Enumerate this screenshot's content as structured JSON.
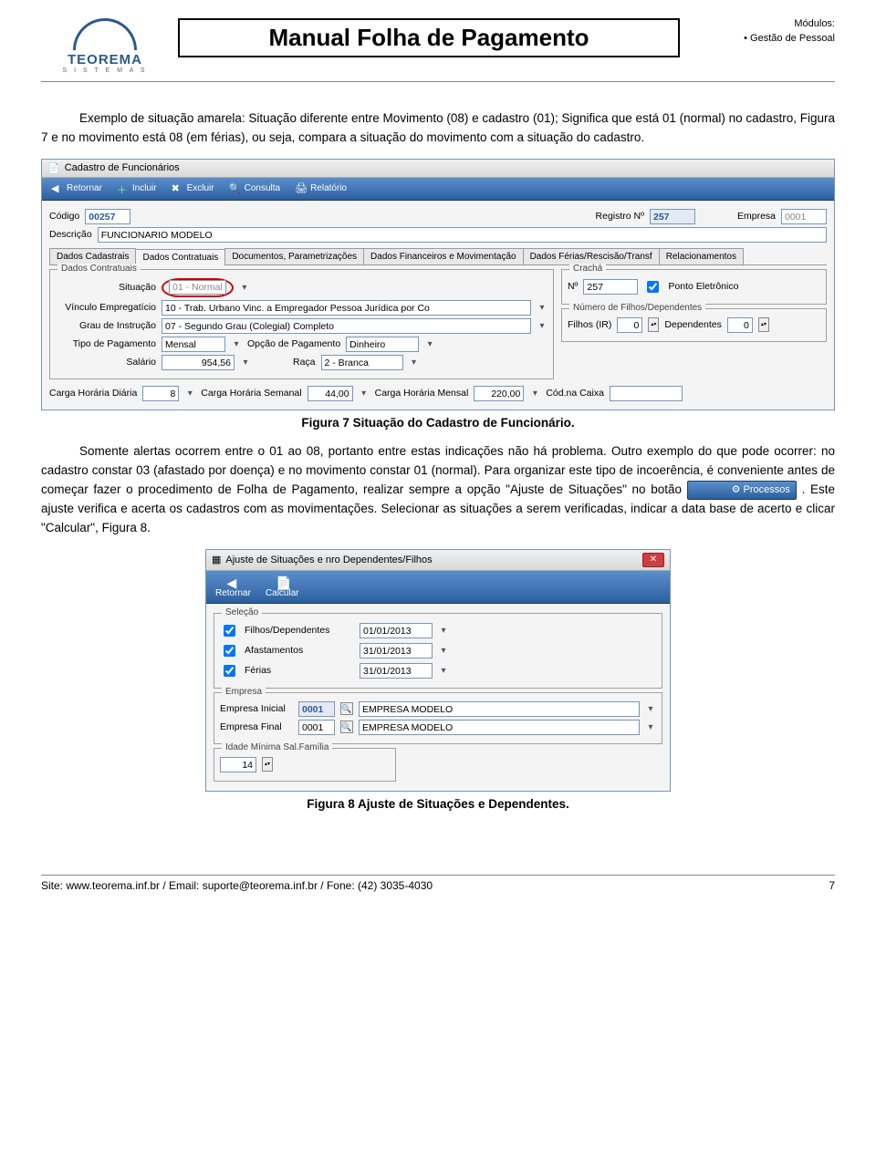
{
  "header": {
    "logo_name": "TEOREMA",
    "logo_sub": "S I S T E M A S",
    "title": "Manual Folha de Pagamento",
    "modules_label": "Módulos:",
    "module_item": "Gestão de Pessoal"
  },
  "para1": "Exemplo de situação amarela: Situação diferente entre Movimento (08) e cadastro (01); Significa que está 01 (normal) no cadastro, Figura 7 e no movimento está 08 (em férias), ou seja, compara a situação do movimento com a situação do cadastro.",
  "fig7": {
    "win_title": "Cadastro de Funcionários",
    "toolbar": {
      "retornar": "Retornar",
      "incluir": "Incluir",
      "excluir": "Excluir",
      "consulta": "Consulta",
      "relatorio": "Relatório"
    },
    "codigo_lbl": "Código",
    "codigo_val": "00257",
    "registro_lbl": "Registro Nº",
    "registro_val": "257",
    "empresa_lbl": "Empresa",
    "empresa_val": "0001",
    "descricao_lbl": "Descrição",
    "descricao_val": "FUNCIONARIO MODELO",
    "tabs": {
      "t1": "Dados Cadastrais",
      "t2": "Dados Contratuais",
      "t3": "Documentos, Parametrizações",
      "t4": "Dados Financeiros e Movimentação",
      "t5": "Dados Férias/Rescisão/Transf",
      "t6": "Relacionamentos"
    },
    "group_contrat": "Dados Contratuais",
    "situacao_lbl": "Situação",
    "situacao_val": "01 - Normal",
    "vinculo_lbl": "Vínculo Empregatício",
    "vinculo_val": "10 - Trab. Urbano Vinc. a Empregador Pessoa Jurídica por Co",
    "grau_lbl": "Grau de Instrução",
    "grau_val": "07 - Segundo Grau (Colegial) Completo",
    "tipopag_lbl": "Tipo de Pagamento",
    "tipopag_val": "Mensal",
    "opcaopag_lbl": "Opção de Pagamento",
    "opcaopag_val": "Dinheiro",
    "salario_lbl": "Salário",
    "salario_val": "954,56",
    "raca_lbl": "Raça",
    "raca_val": "2 - Branca",
    "chd_lbl": "Carga Horária Diária",
    "chd_val": "8",
    "chs_lbl": "Carga Horária Semanal",
    "chs_val": "44,00",
    "chm_lbl": "Carga Horária Mensal",
    "chm_val": "220,00",
    "codcaixa_lbl": "Cód.na Caixa",
    "group_cracha": "Crachá",
    "cracha_no_lbl": "Nº",
    "cracha_no_val": "257",
    "ponto_lbl": "Ponto Eletrônico",
    "group_filhos": "Número de Filhos/Dependentes",
    "filhosir_lbl": "Filhos (IR)",
    "filhosir_val": "0",
    "dependentes_lbl": "Dependentes",
    "dependentes_val": "0"
  },
  "caption7": "Figura 7 Situação do Cadastro de Funcionário.",
  "para2a": "Somente alertas ocorrem entre o 01 ao 08, portanto entre estas indicações não há problema. Outro exemplo do que pode ocorrer: no cadastro constar 03 (afastado por doença) e no movimento constar 01 (normal). Para organizar este tipo de incoerência, é conveniente antes de começar fazer o procedimento de Folha de Pagamento, realizar sempre a opção \"Ajuste de Situações\" no botão ",
  "processos_btn": "Processos",
  "para2b": ". Este ajuste verifica e acerta os cadastros com as movimentações. Selecionar as situações a serem verificadas, indicar a data base de acerto e clicar \"Calcular\", Figura 8.",
  "fig8": {
    "win_title": "Ajuste de Situações e nro Dependentes/Filhos",
    "toolbar": {
      "retornar": "Retornar",
      "calcular": "Calcular"
    },
    "group_selecao": "Seleção",
    "filhos_lbl": "Filhos/Dependentes",
    "filhos_date": "01/01/2013",
    "afast_lbl": "Afastamentos",
    "afast_date": "31/01/2013",
    "ferias_lbl": "Férias",
    "ferias_date": "31/01/2013",
    "group_empresa": "Empresa",
    "emp_ini_lbl": "Empresa Inicial",
    "emp_ini_code": "0001",
    "emp_ini_name": "EMPRESA MODELO",
    "emp_fin_lbl": "Empresa Final",
    "emp_fin_code": "0001",
    "emp_fin_name": "EMPRESA MODELO",
    "group_idade": "Idade Mínima Sal.Família",
    "idade_val": "14"
  },
  "caption8": "Figura 8 Ajuste de Situações e Dependentes.",
  "footer": {
    "left": "Site: www.teorema.inf.br / Email: suporte@teorema.inf.br / Fone: (42) 3035-4030",
    "right": "7"
  }
}
